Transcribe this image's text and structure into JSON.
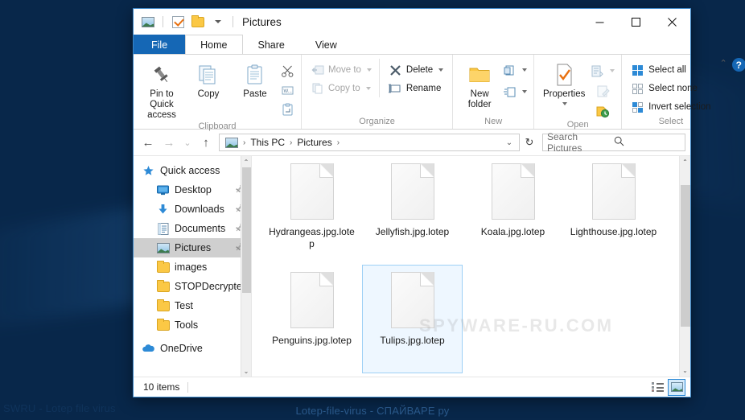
{
  "wallpaper": {
    "caption_center": "Lotep-file-virus - СПАЙВАРЕ ру",
    "caption_left": "SWRU - Lotep file virus"
  },
  "window": {
    "title": "Pictures",
    "quick_access_icons": [
      "pictures-icon",
      "checkmark-icon",
      "folder-icon",
      "customize-chevron-icon"
    ],
    "controls": {
      "minimize": "—",
      "maximize": "☐",
      "close": "✕"
    }
  },
  "tabs": [
    {
      "label": "File",
      "type": "file"
    },
    {
      "label": "Home",
      "type": "active"
    },
    {
      "label": "Share",
      "type": "normal"
    },
    {
      "label": "View",
      "type": "normal"
    }
  ],
  "ribbon": {
    "collapse_label": "⌃",
    "help_label": "?",
    "groups": [
      {
        "name": "Clipboard",
        "label": "Clipboard",
        "big_buttons": [
          {
            "label": "Pin to Quick access",
            "icon": "pin-icon"
          },
          {
            "label": "Copy",
            "icon": "copy-icon"
          },
          {
            "label": "Paste",
            "icon": "paste-icon"
          }
        ],
        "mini_buttons": [
          {
            "icon": "cut-scissors-icon"
          },
          {
            "icon": "copy-path-icon"
          },
          {
            "icon": "paste-shortcut-icon"
          }
        ]
      },
      {
        "name": "Organize",
        "label": "Organize",
        "small_buttons": [
          {
            "label": "Move to",
            "icon": "move-to-icon",
            "dropdown": true,
            "disabled": true
          },
          {
            "label": "Copy to",
            "icon": "copy-to-icon",
            "dropdown": true,
            "disabled": true
          },
          {
            "label": "Delete",
            "icon": "delete-x-icon",
            "dropdown": true,
            "disabled": false
          },
          {
            "label": "Rename",
            "icon": "rename-icon",
            "dropdown": false,
            "disabled": false
          }
        ]
      },
      {
        "name": "New",
        "label": "New",
        "big_buttons": [
          {
            "label": "New folder",
            "icon": "new-folder-icon"
          }
        ],
        "small_buttons": [
          {
            "label": "",
            "icon": "new-item-icon",
            "dropdown": true
          },
          {
            "label": "",
            "icon": "easy-access-icon",
            "dropdown": true
          }
        ]
      },
      {
        "name": "Open",
        "label": "Open",
        "big_buttons": [
          {
            "label": "Properties",
            "icon": "properties-icon",
            "dropdown": true
          }
        ],
        "mini_buttons": [
          {
            "icon": "open-icon",
            "dropdown": true,
            "disabled": false
          },
          {
            "icon": "edit-icon",
            "disabled": true
          },
          {
            "icon": "history-icon",
            "disabled": false
          }
        ]
      },
      {
        "name": "Select",
        "label": "Select",
        "small_buttons": [
          {
            "label": "Select all",
            "icon": "select-all-icon"
          },
          {
            "label": "Select none",
            "icon": "select-none-icon"
          },
          {
            "label": "Invert selection",
            "icon": "invert-selection-icon"
          }
        ]
      }
    ]
  },
  "addressbar": {
    "back": "←",
    "forward": "→",
    "recent": "⌄",
    "up": "↑",
    "breadcrumb": [
      "This PC",
      "Pictures"
    ],
    "breadcrumb_sep": "›",
    "dropdown": "⌄",
    "refresh": "↻",
    "search_placeholder": "Search Pictures",
    "search_value": ""
  },
  "navpane": {
    "items": [
      {
        "label": "Quick access",
        "icon": "star-pin-icon",
        "indent": false,
        "pinned": false,
        "selected": false
      },
      {
        "label": "Desktop",
        "icon": "desktop-icon",
        "indent": true,
        "pinned": true,
        "selected": false
      },
      {
        "label": "Downloads",
        "icon": "downloads-arrow-icon",
        "indent": true,
        "pinned": true,
        "selected": false
      },
      {
        "label": "Documents",
        "icon": "documents-icon",
        "indent": true,
        "pinned": true,
        "selected": false
      },
      {
        "label": "Pictures",
        "icon": "pictures-icon",
        "indent": true,
        "pinned": true,
        "selected": true
      },
      {
        "label": "images",
        "icon": "folder-icon",
        "indent": true,
        "pinned": false,
        "selected": false
      },
      {
        "label": "STOPDecrypter",
        "icon": "folder-icon",
        "indent": true,
        "pinned": false,
        "selected": false
      },
      {
        "label": "Test",
        "icon": "folder-icon",
        "indent": true,
        "pinned": false,
        "selected": false
      },
      {
        "label": "Tools",
        "icon": "folder-icon",
        "indent": true,
        "pinned": false,
        "selected": false
      },
      {
        "label": "OneDrive",
        "icon": "onedrive-cloud-icon",
        "indent": false,
        "pinned": false,
        "selected": false
      }
    ],
    "pin_glyph": "📌",
    "scroll_up": "⌃",
    "scroll_down": "⌄"
  },
  "files": {
    "watermark": "SPYWARE-RU.COM",
    "items": [
      {
        "name": "Hydrangeas.jpg.lotep",
        "selected": false
      },
      {
        "name": "Jellyfish.jpg.lotep",
        "selected": false
      },
      {
        "name": "Koala.jpg.lotep",
        "selected": false
      },
      {
        "name": "Lighthouse.jpg.lotep",
        "selected": false
      },
      {
        "name": "Penguins.jpg.lotep",
        "selected": false
      },
      {
        "name": "Tulips.jpg.lotep",
        "selected": true
      }
    ],
    "scroll_up": "⌃",
    "scroll_down": "⌄"
  },
  "statusbar": {
    "item_count": "10 items",
    "view_details_icon": "details-view-icon",
    "view_large_icons_icon": "large-icons-view-icon"
  }
}
